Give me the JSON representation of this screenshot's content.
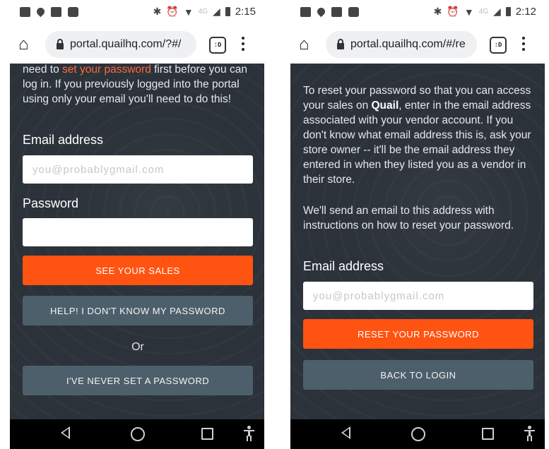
{
  "colors": {
    "accent": "#ff5312",
    "link": "#ff6a3d",
    "secondary_button": "#4d5f6b",
    "background": "#2b3239"
  },
  "left": {
    "status": {
      "time": "2:15",
      "network": "4G"
    },
    "url": "portal.quailhq.com/?#/",
    "tab_icon": ":D",
    "intro": {
      "pre": "need to ",
      "link": "set your password",
      "post": " first before you can log in. If you previously logged into the portal using only your email you'll need to do this!"
    },
    "email_label": "Email address",
    "email_placeholder": "you@probablygmail.com",
    "password_label": "Password",
    "password_value": "",
    "see_sales_button": "SEE YOUR SALES",
    "forgot_button": "HELP! I DON'T KNOW MY PASSWORD",
    "or_text": "Or",
    "never_set_button": "I'VE NEVER SET A PASSWORD"
  },
  "right": {
    "status": {
      "time": "2:12",
      "network": "4G"
    },
    "url": "portal.quailhq.com/#/re",
    "tab_icon": ":D",
    "intro": {
      "pre": "To reset your password so that you can access your sales on ",
      "brand": "Quail",
      "post": ", enter in the email address associated with your vendor account. If you don't know what email address this is, ask your store owner -- it'll be the email address they entered in when they listed you as a vendor in their store."
    },
    "note": "We'll send an email to this address with instructions on how to reset your password.",
    "email_label": "Email address",
    "email_placeholder": "you@probablygmail.com",
    "reset_button": "RESET YOUR PASSWORD",
    "back_button": "BACK TO LOGIN"
  }
}
